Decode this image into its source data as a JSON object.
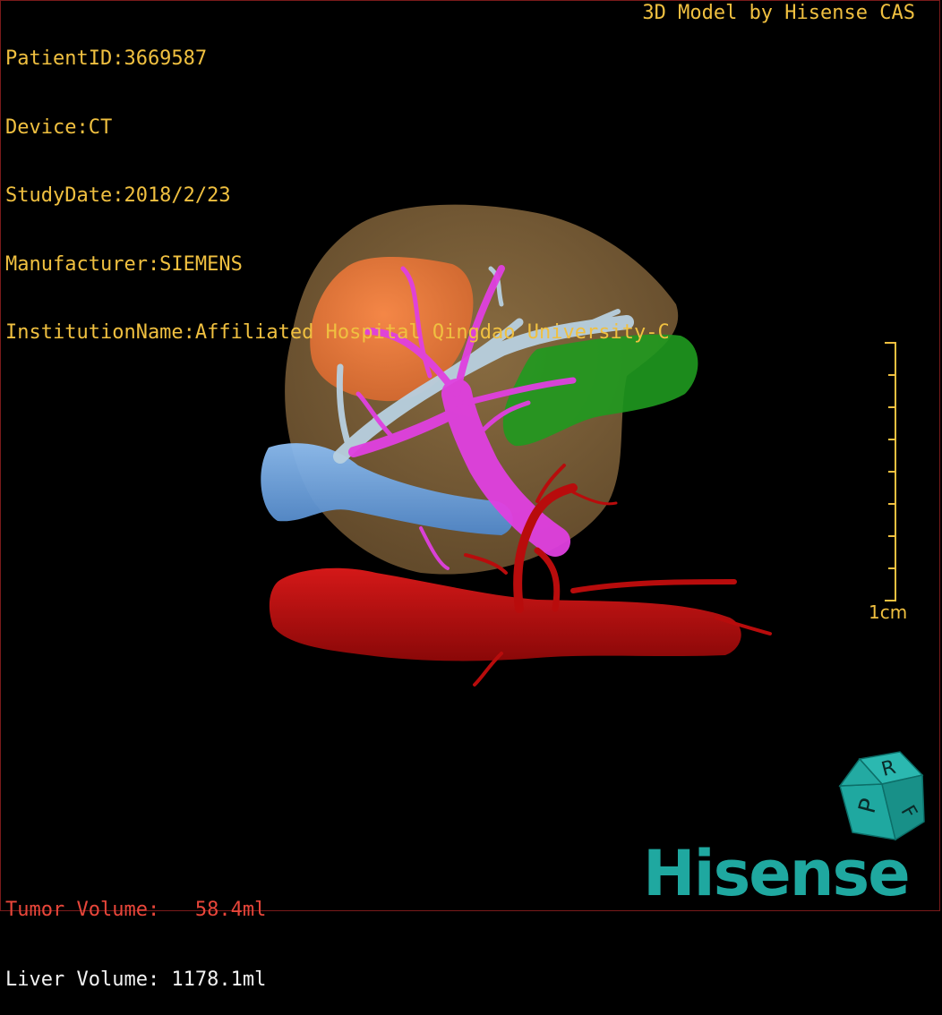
{
  "header": {
    "patient_id": "PatientID:3669587",
    "device": "Device:CT",
    "study_date": "StudyDate:2018/2/23",
    "manufacturer": "Manufacturer:SIEMENS",
    "institution": "InstitutionName:Affiliated Hospital Qingdao University-C",
    "credit": "3D Model by Hisense CAS"
  },
  "volumes": {
    "tumor_label": "Tumor Volume:   58.4ml",
    "liver_label": "Liver Volume: 1178.1ml"
  },
  "scale_bar": {
    "label": "1cm"
  },
  "orientation_cube": {
    "letters": [
      "P",
      "R",
      "F"
    ]
  },
  "brand": {
    "logo_text": "Hisense"
  },
  "colors": {
    "info_text": "#f0c040",
    "tumor_text": "#e8463a",
    "liver": "#8a6a3c",
    "tumor": "#f07a40",
    "hepatic_vein": "#b8d0e0",
    "portal_vein": "#e040e0",
    "inferior_vena_cava": "#6fa8e8",
    "artery": "#c01010",
    "spleen_region": "#20a020",
    "logo": "#1fa8a0"
  }
}
